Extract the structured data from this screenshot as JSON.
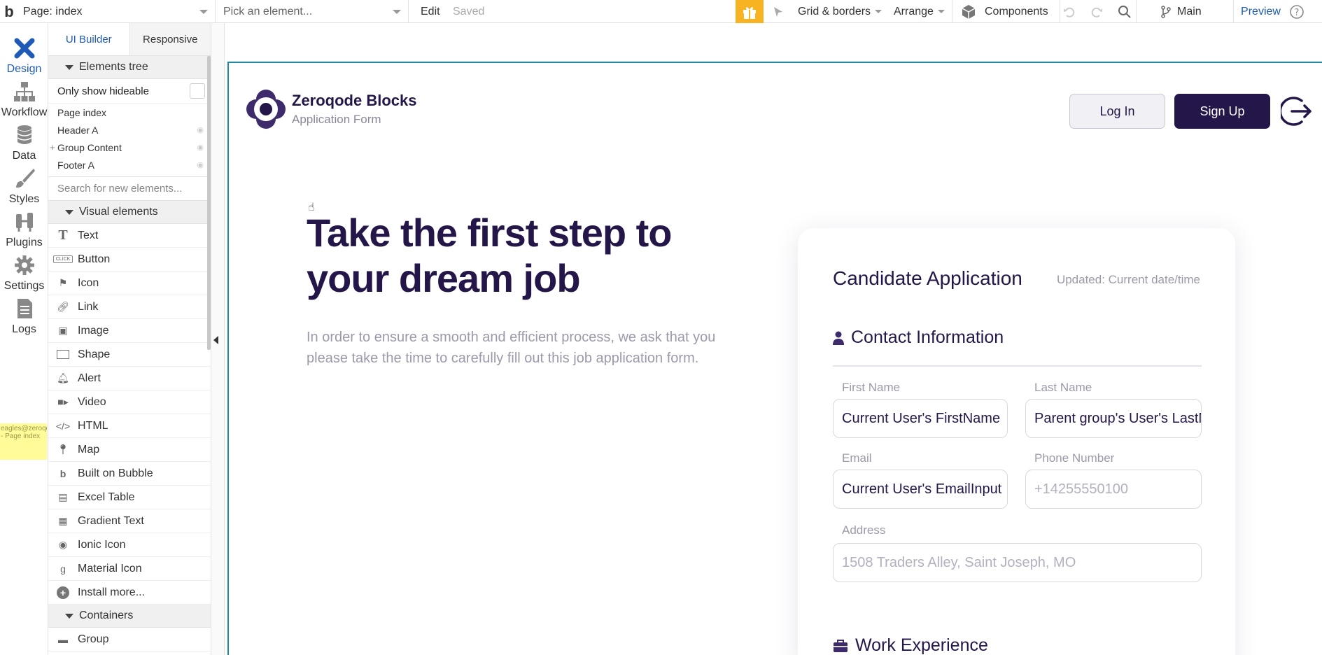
{
  "topbar": {
    "logo": "b",
    "page_select": "Page: index",
    "element_select_placeholder": "Pick an element...",
    "edit": "Edit",
    "saved": "Saved",
    "grid": "Grid & borders",
    "arrange": "Arrange",
    "components": "Components",
    "branch": "Main",
    "preview": "Preview",
    "help": "?"
  },
  "rail": {
    "items": [
      {
        "label": "Design",
        "icon": "design-icon"
      },
      {
        "label": "Workflow",
        "icon": "workflow-icon"
      },
      {
        "label": "Data",
        "icon": "database-icon"
      },
      {
        "label": "Styles",
        "icon": "brush-icon"
      },
      {
        "label": "Plugins",
        "icon": "plug-icon"
      },
      {
        "label": "Settings",
        "icon": "gear-icon"
      },
      {
        "label": "Logs",
        "icon": "document-icon"
      }
    ],
    "user_tag": "eagles@zeroqode.com - Page index"
  },
  "panel": {
    "tabs": [
      "UI Builder",
      "Responsive"
    ],
    "elements_tree": "Elements tree",
    "only_show_hideable": "Only show hideable",
    "tree": [
      "Page index",
      "Header A",
      "Group Content",
      "Footer A"
    ],
    "search_placeholder": "Search for new elements...",
    "visual_elements": "Visual elements",
    "visual_items": [
      "Text",
      "Button",
      "Icon",
      "Link",
      "Image",
      "Shape",
      "Alert",
      "Video",
      "HTML",
      "Map",
      "Built on Bubble",
      "Excel Table",
      "Gradient Text",
      "Ionic Icon",
      "Material Icon",
      "Install more..."
    ],
    "containers": "Containers",
    "container_items": [
      "Group"
    ]
  },
  "canvas": {
    "brand_title": "Zeroqode Blocks",
    "brand_sub": "Application Form",
    "login": "Log In",
    "signup": "Sign Up",
    "hero_title": "Take the first step to your dream job",
    "hero_desc": "In order to ensure a smooth and efficient process, we ask that you please take the time to carefully fill out this job application form.",
    "card": {
      "title": "Candidate Application",
      "updated": "Updated: Current date/time",
      "contact_heading": "Contact Information",
      "first_name_label": "First Name",
      "first_name_value": "Current User's FirstName",
      "last_name_label": "Last Name",
      "last_name_value": "Parent group's User's LastName",
      "email_label": "Email",
      "email_value": "Current User's EmailInput",
      "phone_label": "Phone Number",
      "phone_placeholder": "+14255550100",
      "address_label": "Address",
      "address_placeholder": "1508 Traders Alley, Saint Joseph, MO",
      "work_heading": "Work Experience"
    },
    "colors": {
      "brand": "#241648",
      "accent": "#1e8aa6",
      "gift": "#f7b321"
    }
  }
}
